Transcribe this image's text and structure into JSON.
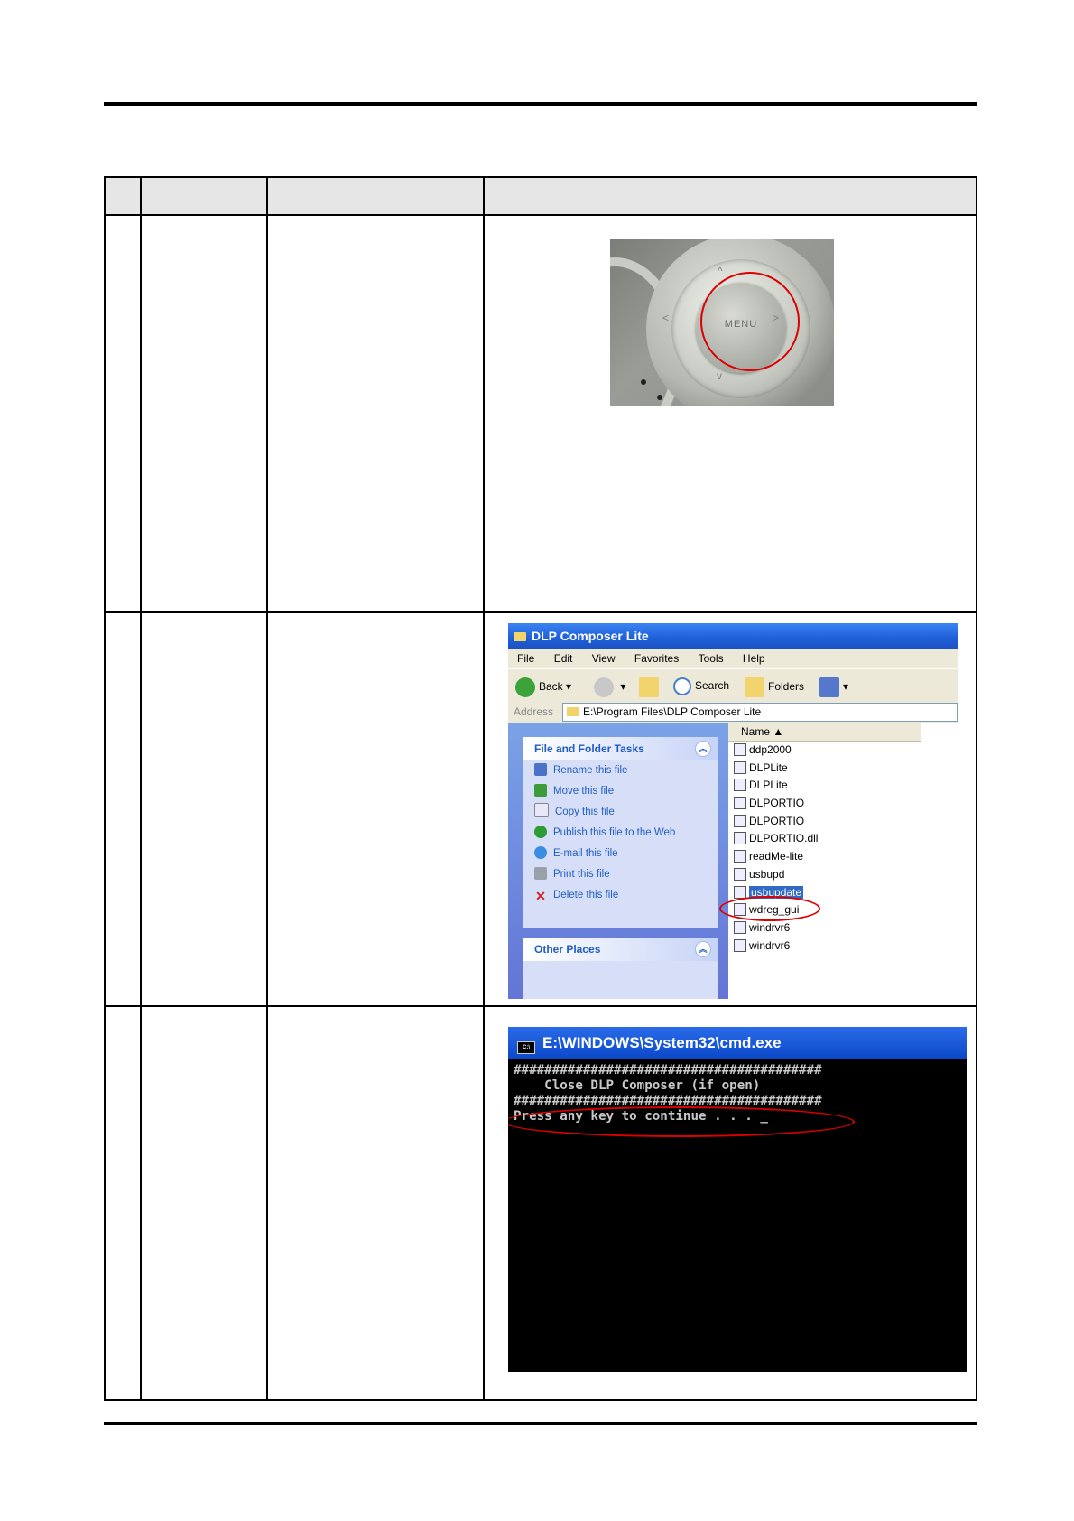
{
  "explorer": {
    "title": "DLP Composer Lite",
    "menu": [
      "File",
      "Edit",
      "View",
      "Favorites",
      "Tools",
      "Help"
    ],
    "toolbar": {
      "back": "Back",
      "search": "Search",
      "folders": "Folders"
    },
    "address_label": "Address",
    "address_value": "E:\\Program Files\\DLP Composer Lite",
    "tasks_header": "File and Folder Tasks",
    "tasks": [
      "Rename this file",
      "Move this file",
      "Copy this file",
      "Publish this file to the Web",
      "E-mail this file",
      "Print this file",
      "Delete this file"
    ],
    "task_icon_colors": [
      "#4a73c8",
      "#3e9b3a",
      "#e8e8f8",
      "#2f9b36",
      "#3a8de0",
      "#9aa0aa",
      "#d02020"
    ],
    "other_places_header": "Other Places",
    "name_column": "Name",
    "files": [
      "ddp2000",
      "DLPLite",
      "DLPLite",
      "DLPORTIO",
      "DLPORTIO",
      "DLPORTIO.dll",
      "readMe-lite",
      "usbupd",
      "usbupdate",
      "wdreg_gui",
      "windrvr6",
      "windrvr6"
    ],
    "selected_file": "usbupdate"
  },
  "remote": {
    "button_label": "MENU"
  },
  "cmd": {
    "title": "E:\\WINDOWS\\System32\\cmd.exe",
    "lines": [
      "########################################",
      "    Close DLP Composer (if open)",
      "########################################",
      "Press any key to continue . . . _"
    ]
  },
  "colors": {
    "highlight_circle": "#dd0000",
    "xp_titlebar": "#1f5fd8",
    "xp_selection": "#316ac5"
  }
}
